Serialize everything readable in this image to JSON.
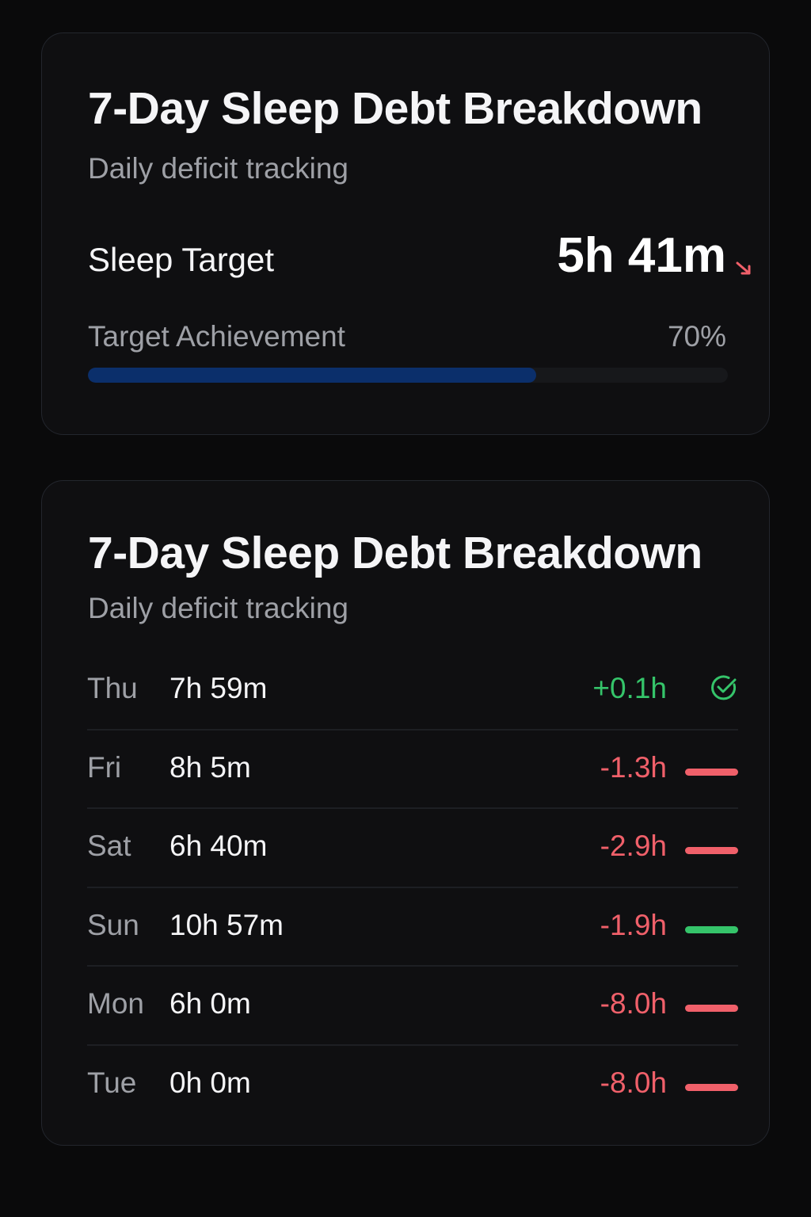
{
  "colors": {
    "positive": "#35c46a",
    "negative": "#f0606a",
    "progress": "#0b2f6b"
  },
  "summary_card": {
    "title": "7-Day Sleep Debt Breakdown",
    "subtitle": "Daily deficit tracking",
    "target_label": "Sleep Target",
    "target_value": "5h 41m",
    "trend_icon": "arrow-down-right-icon",
    "achievement_label": "Target Achievement",
    "achievement_value": "70%",
    "achievement_fraction": 0.7
  },
  "breakdown_card": {
    "title": "7-Day Sleep Debt Breakdown",
    "subtitle": "Daily deficit tracking",
    "days": [
      {
        "day": "Thu",
        "duration": "7h 59m",
        "deficit": "+0.1h",
        "status": "positive",
        "indicator": "check-circle-icon"
      },
      {
        "day": "Fri",
        "duration": "8h 5m",
        "deficit": "-1.3h",
        "status": "negative",
        "indicator": "bar",
        "bar_color": "negative"
      },
      {
        "day": "Sat",
        "duration": "6h 40m",
        "deficit": "-2.9h",
        "status": "negative",
        "indicator": "bar",
        "bar_color": "negative"
      },
      {
        "day": "Sun",
        "duration": "10h 57m",
        "deficit": "-1.9h",
        "status": "negative",
        "indicator": "bar",
        "bar_color": "positive"
      },
      {
        "day": "Mon",
        "duration": "6h 0m",
        "deficit": "-8.0h",
        "status": "negative",
        "indicator": "bar",
        "bar_color": "negative"
      },
      {
        "day": "Tue",
        "duration": "0h 0m",
        "deficit": "-8.0h",
        "status": "negative",
        "indicator": "bar",
        "bar_color": "negative"
      }
    ]
  }
}
